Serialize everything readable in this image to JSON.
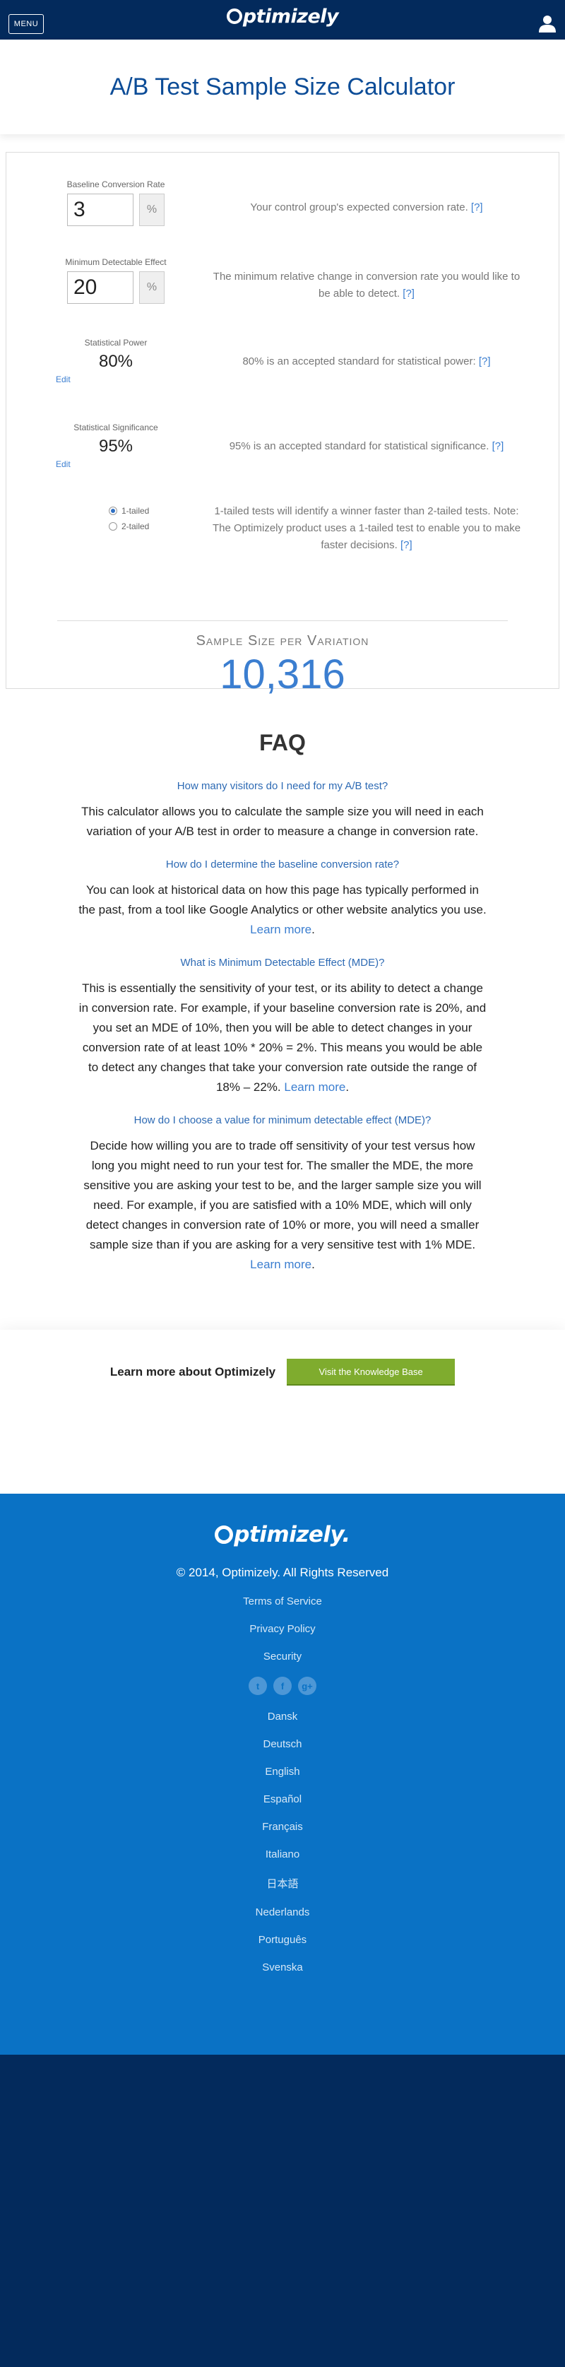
{
  "header": {
    "menu_label": "MENU",
    "brand": "ptimizely",
    "title": "A/B Test Sample Size Calculator"
  },
  "calculator": {
    "baseline": {
      "label": "Baseline Conversion Rate",
      "value": "3",
      "unit": "%",
      "desc": "Your control group's expected conversion rate.",
      "help": "[?]"
    },
    "mde": {
      "label": "Minimum Detectable Effect",
      "value": "20",
      "unit": "%",
      "desc": "The minimum relative change in conversion rate you would like to be able to detect.",
      "help": "[?]"
    },
    "power": {
      "label": "Statistical Power",
      "value": "80%",
      "edit": "Edit",
      "desc": "80% is an accepted standard for statistical power:",
      "help": "[?]"
    },
    "significance": {
      "label": "Statistical Significance",
      "value": "95%",
      "edit": "Edit",
      "desc": "95% is an accepted standard for statistical significance.",
      "help": "[?]"
    },
    "tails": {
      "one": "1-tailed",
      "two": "2-tailed",
      "selected": "1-tailed",
      "desc": "1-tailed tests will identify a winner faster than 2-tailed tests. Note: The Optimizely product uses a 1-tailed test to enable you to make faster decisions.",
      "help": "[?]"
    },
    "result_label": "Sample Size per Variation",
    "result_value": "10,316"
  },
  "faq": {
    "title": "FAQ",
    "items": [
      {
        "q": "How many visitors do I need for my A/B test?",
        "a": "This calculator allows you to calculate the sample size you will need in each variation of your A/B test in order to measure a change in conversion rate.",
        "link": ""
      },
      {
        "q": "How do I determine the baseline conversion rate?",
        "a": "You can look at historical data on how this page has typically performed in the past, from a tool like Google Analytics or other website analytics you use.",
        "link": "Learn more"
      },
      {
        "q": "What is Minimum Detectable Effect (MDE)?",
        "a": "This is essentially the sensitivity of your test, or its ability to detect a change in conversion rate. For example, if your baseline conversion rate is 20%, and you set an MDE of 10%, then you will be able to detect changes in your conversion rate of at least 10% * 20% = 2%. This means you would be able to detect any changes that take your conversion rate outside the range of 18% – 22%.",
        "link": "Learn more"
      },
      {
        "q": "How do I choose a value for minimum detectable effect (MDE)?",
        "a": "Decide how willing you are to trade off sensitivity of your test versus how long you might need to run your test for. The smaller the MDE, the more sensitive you are asking your test to be, and the larger sample size you will need. For example, if you are satisfied with a 10% MDE, which will only detect changes in conversion rate of 10% or more, you will need a smaller sample size than if you are asking for a very sensitive test with 1% MDE.",
        "link": "Learn more"
      }
    ]
  },
  "learn": {
    "text": "Learn more about Optimizely",
    "button": "Visit the Knowledge Base"
  },
  "footer": {
    "brand": "ptimizely.",
    "copyright": "© 2014, Optimizely. All Rights Reserved",
    "links": [
      "Terms of Service",
      "Privacy Policy",
      "Security"
    ],
    "social": [
      "twitter-icon",
      "facebook-icon",
      "google-plus-icon"
    ],
    "languages": [
      "Dansk",
      "Deutsch",
      "English",
      "Español",
      "Français",
      "Italiano",
      "日本語",
      "Nederlands",
      "Português",
      "Svenska"
    ]
  },
  "colors": {
    "navy": "#032a5c",
    "footer_blue": "#0a72c5",
    "link_blue": "#3b7ed0",
    "button_green": "#7fac2e"
  }
}
